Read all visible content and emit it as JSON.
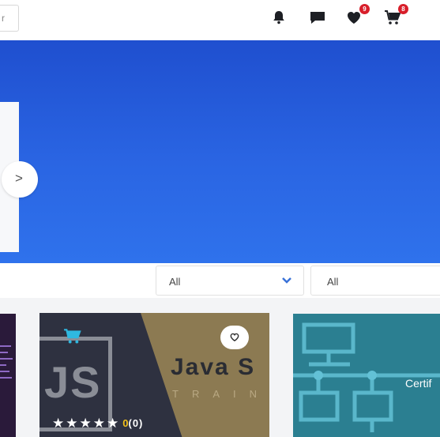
{
  "header": {
    "search_fragment": "r",
    "icons": {
      "notifications": "bell-icon",
      "messages": "chat-icon",
      "wishlist": "heart-icon",
      "cart": "cart-icon"
    },
    "wishlist_count": "9",
    "cart_count": "8",
    "accent_color": "#d81e2a"
  },
  "hero": {
    "next_label": ">",
    "gradient": [
      "#1f4fcf",
      "#2f72ec"
    ]
  },
  "filters": {
    "first_select": {
      "value": "All"
    },
    "second_select": {
      "value": "All"
    },
    "chevron_color": "#3a72d8"
  },
  "courses": [
    {
      "title_text": "Java S",
      "subtitle_text": "TRAIN",
      "logo_letters": "JS",
      "rating_value": "0",
      "rating_count": "(0)",
      "stars": 5
    },
    {
      "title_text": "Certif"
    }
  ]
}
